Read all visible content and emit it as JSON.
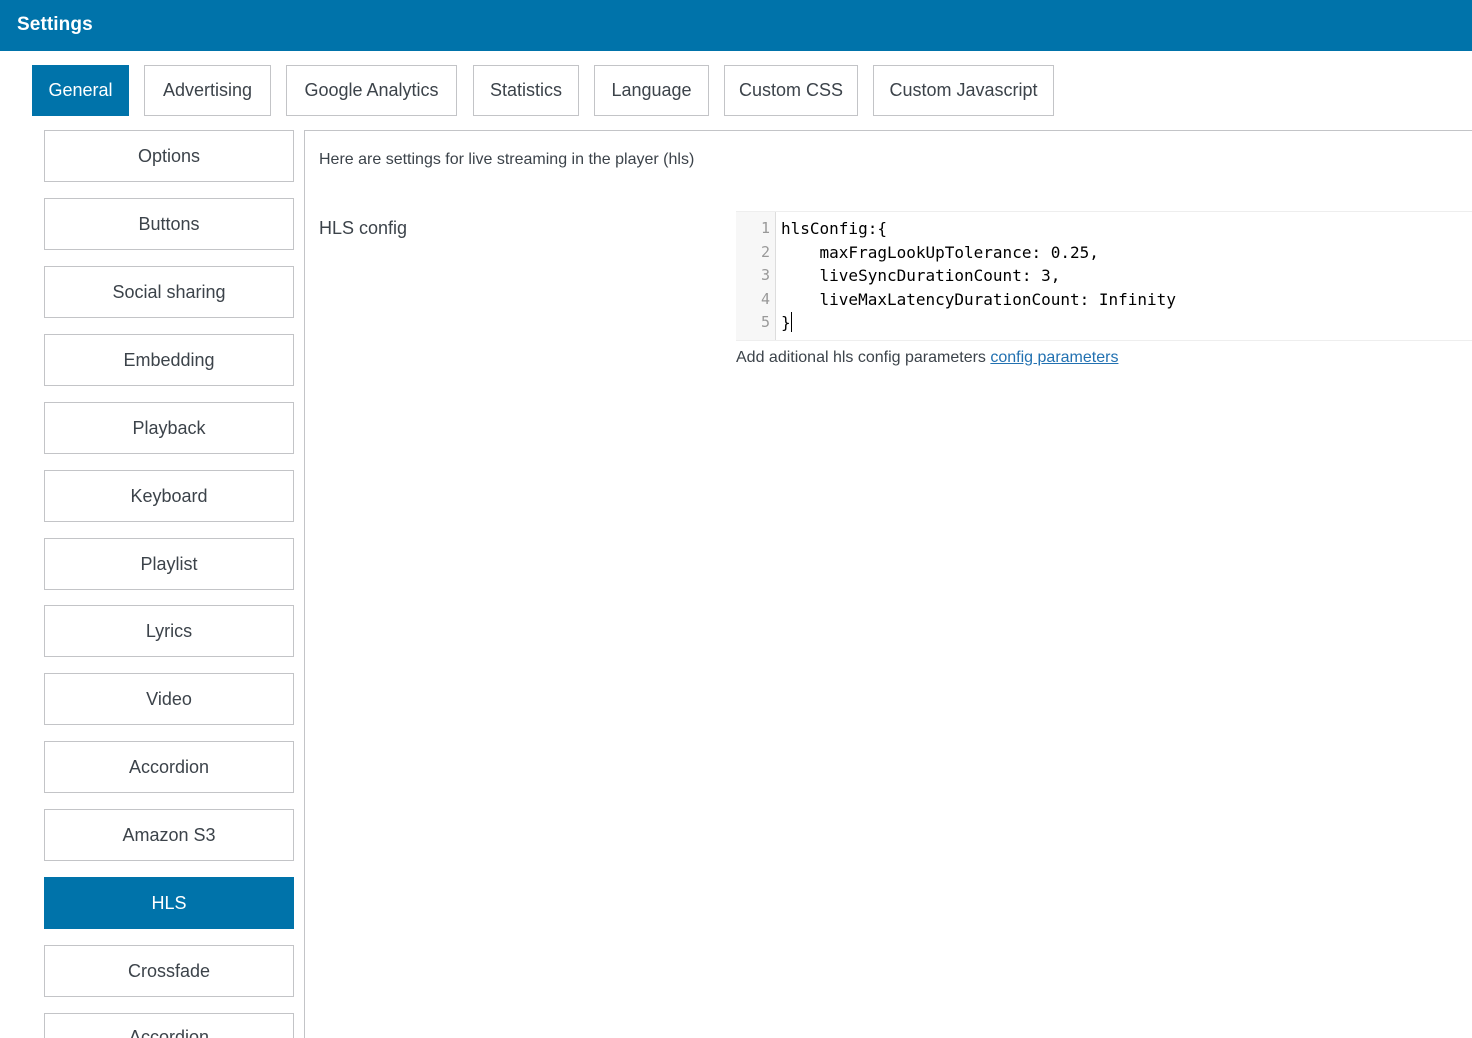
{
  "header": {
    "title": "Settings"
  },
  "tabs": [
    {
      "label": "General",
      "active": true
    },
    {
      "label": "Advertising"
    },
    {
      "label": "Google Analytics"
    },
    {
      "label": "Statistics"
    },
    {
      "label": "Language"
    },
    {
      "label": "Custom CSS"
    },
    {
      "label": "Custom Javascript"
    }
  ],
  "sidebar": {
    "items": [
      {
        "label": "Options"
      },
      {
        "label": "Buttons"
      },
      {
        "label": "Social sharing"
      },
      {
        "label": "Embedding"
      },
      {
        "label": "Playback"
      },
      {
        "label": "Keyboard"
      },
      {
        "label": "Playlist"
      },
      {
        "label": "Lyrics"
      },
      {
        "label": "Video"
      },
      {
        "label": "Accordion"
      },
      {
        "label": "Amazon S3"
      },
      {
        "label": "HLS",
        "active": true
      },
      {
        "label": "Crossfade"
      },
      {
        "label": "Accordion"
      }
    ]
  },
  "panel": {
    "description": "Here are settings for live streaming in the player (hls)",
    "field_label": "HLS config",
    "editor": {
      "line_numbers": [
        "1",
        "2",
        "3",
        "4",
        "5"
      ],
      "lines": [
        "hlsConfig:{",
        "    maxFragLookUpTolerance: 0.25,",
        "    liveSyncDurationCount: 3,",
        "    liveMaxLatencyDurationCount: Infinity",
        "}"
      ]
    },
    "help_text": "Add aditional hls config parameters ",
    "help_link": "config parameters"
  },
  "colors": {
    "accent": "#0073aa",
    "link": "#2271b1",
    "border": "#c3c4c7"
  }
}
